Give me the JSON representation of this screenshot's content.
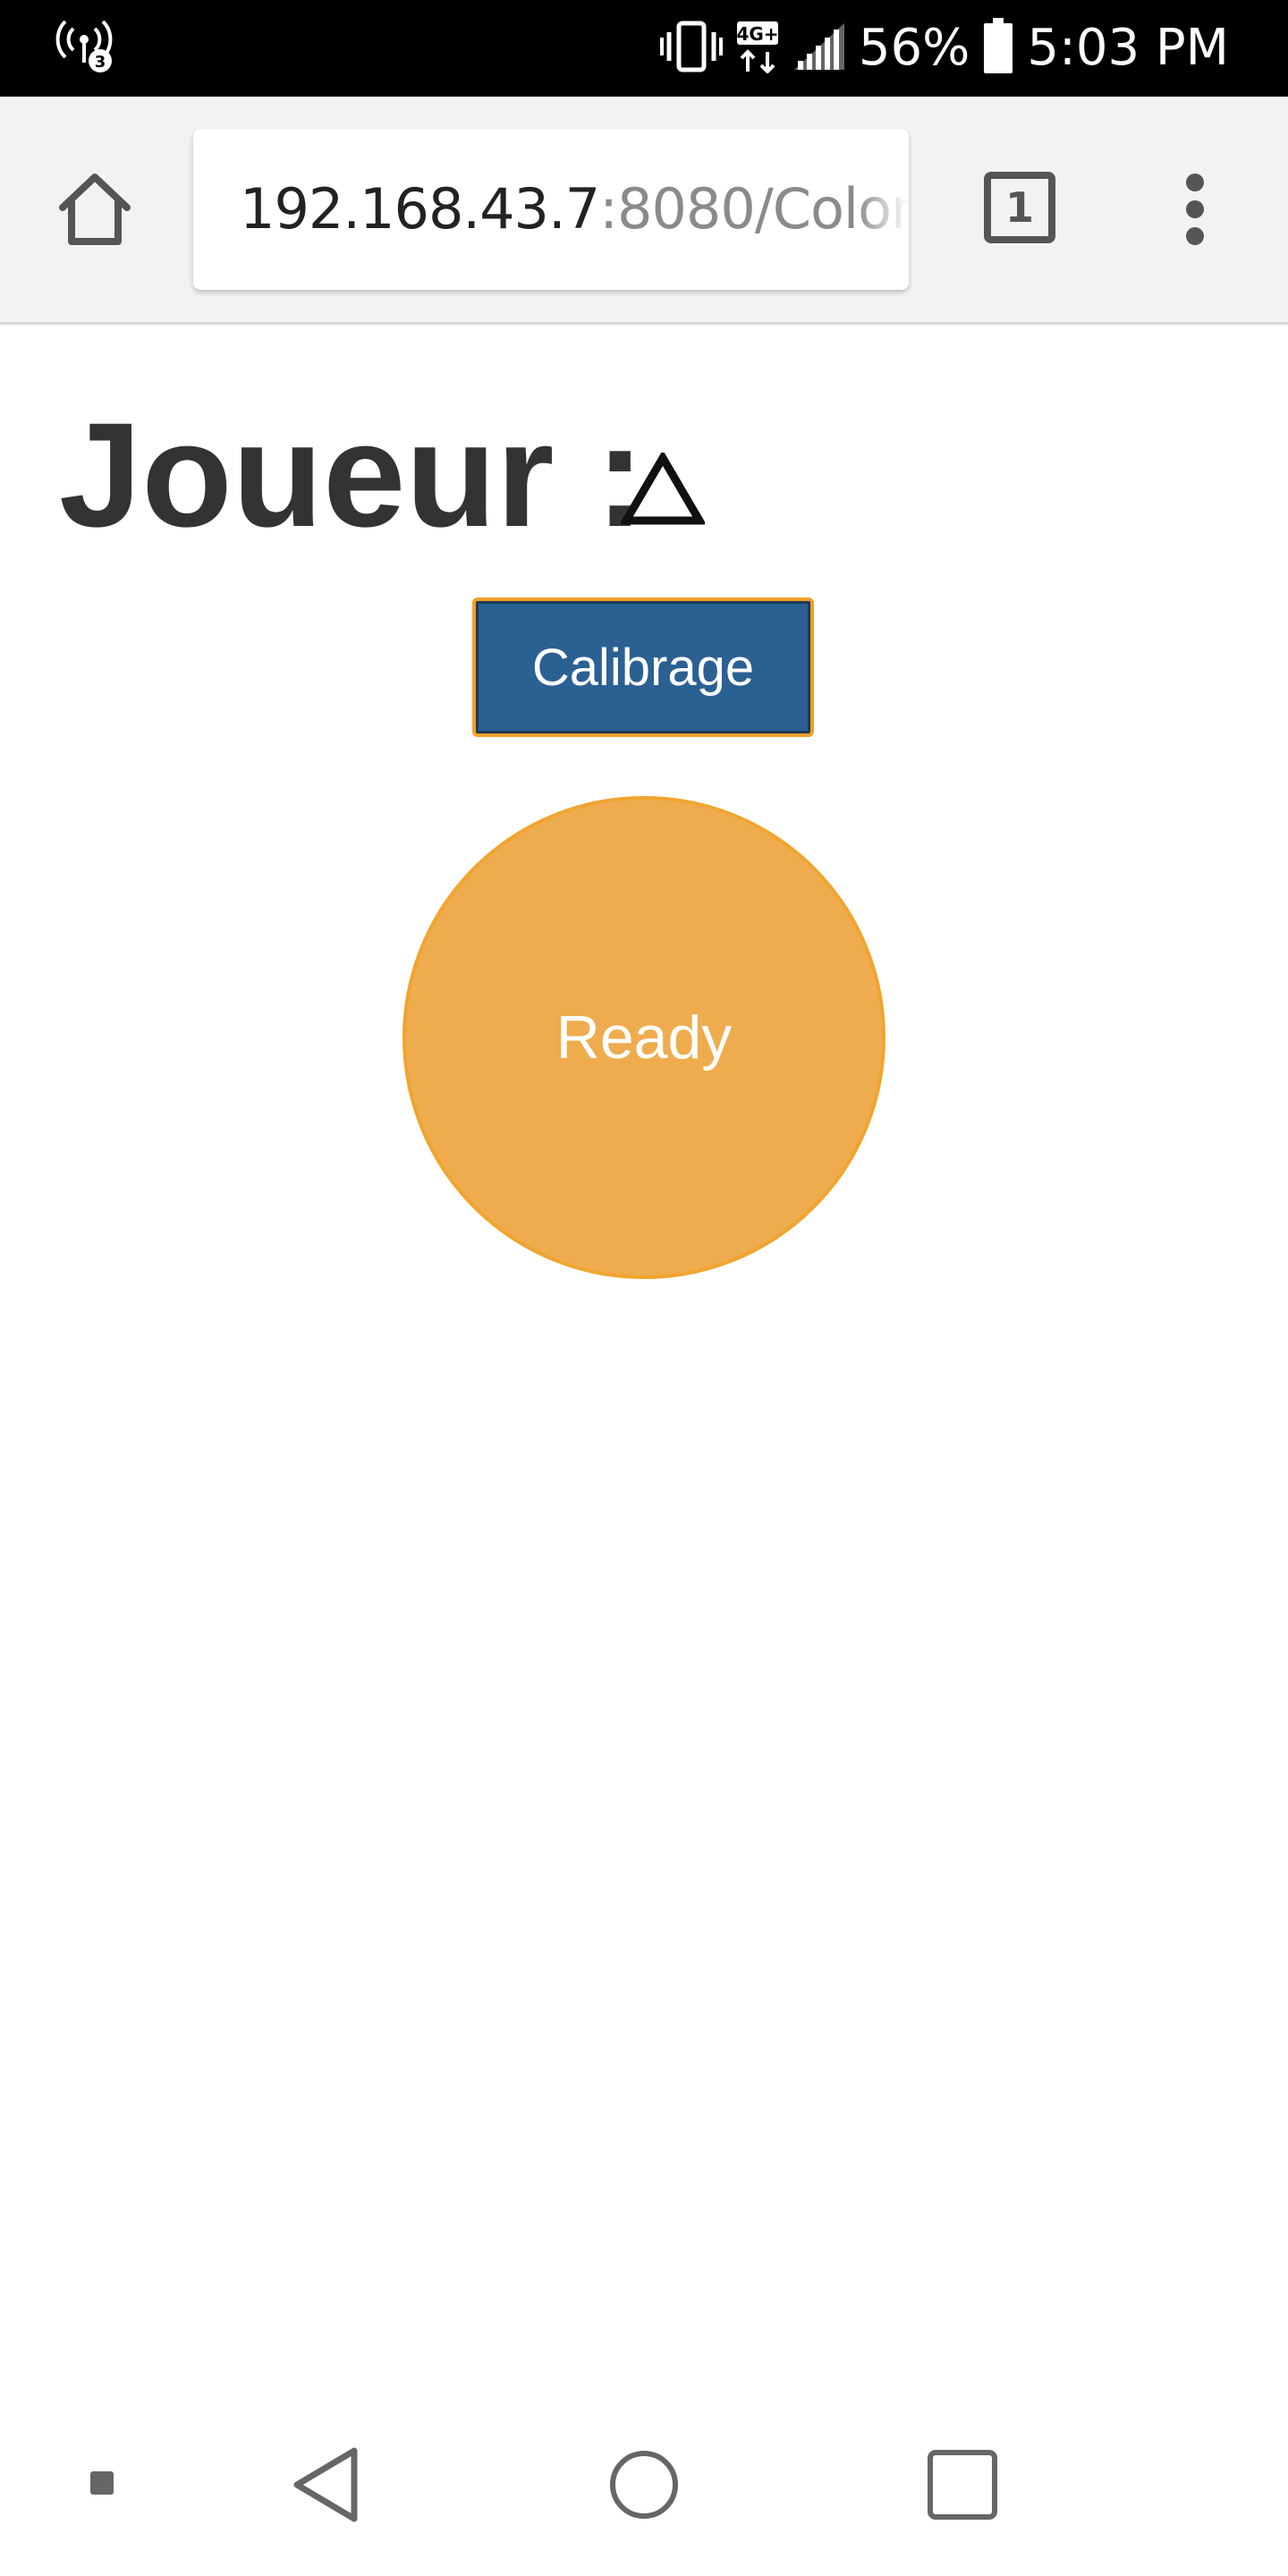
{
  "status_bar": {
    "battery_percent": "56%",
    "time": "5:03 PM",
    "network_type": "4G+",
    "icons": [
      "hotspot-icon",
      "vibrate-icon",
      "data-4g-icon",
      "signal-icon",
      "battery-icon"
    ]
  },
  "browser": {
    "url_host": "192.168.43.7",
    "url_path": ":8080/Color",
    "tab_count": "1",
    "icons": [
      "home-icon",
      "tabs-icon",
      "more-vert-icon"
    ]
  },
  "page": {
    "title": "Joueur :",
    "calibrage_label": "Calibrage",
    "ready_label": "Ready",
    "colors": {
      "button_bg": "#2b6093",
      "button_border": "#f0a127",
      "circle_bg": "#eeac4e",
      "title_text": "#333333"
    }
  },
  "nav_bar": {
    "icons": [
      "recent-dot-icon",
      "back-icon",
      "home-circle-icon",
      "overview-icon"
    ]
  }
}
